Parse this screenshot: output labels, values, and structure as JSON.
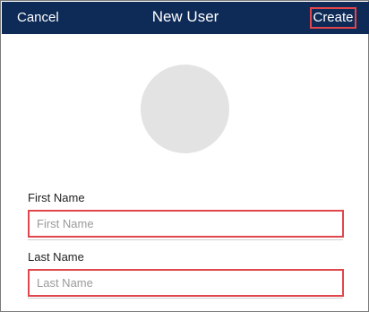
{
  "navbar": {
    "cancel_label": "Cancel",
    "title": "New User",
    "create_label": "Create"
  },
  "avatar": {
    "color": "#e3e3e3"
  },
  "form": {
    "first_name": {
      "label": "First Name",
      "placeholder": "First Name",
      "value": ""
    },
    "last_name": {
      "label": "Last Name",
      "placeholder": "Last Name",
      "value": ""
    }
  },
  "colors": {
    "navbar_bg": "#0e2a57",
    "highlight": "#e0474c"
  }
}
